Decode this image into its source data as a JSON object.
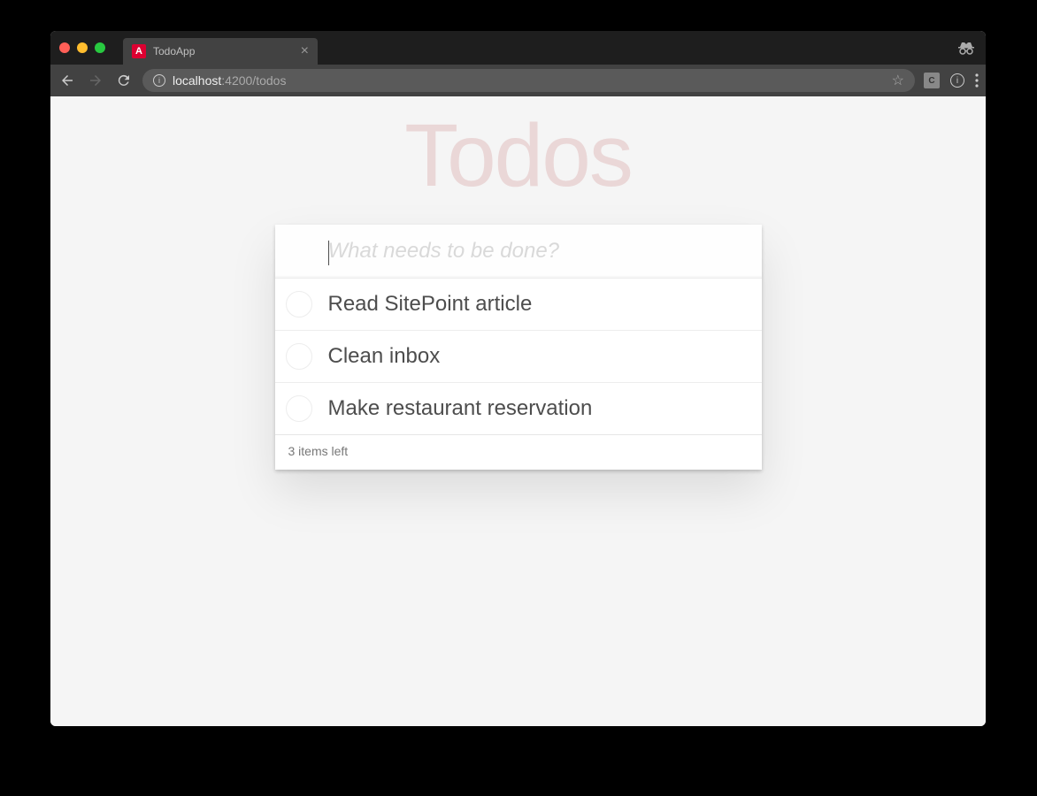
{
  "browser": {
    "tab_title": "TodoApp",
    "url_host": "localhost",
    "url_path": ":4200/todos"
  },
  "app": {
    "title": "Todos",
    "input_placeholder": "What needs to be done?",
    "todos": [
      {
        "label": "Read SitePoint article"
      },
      {
        "label": "Clean inbox"
      },
      {
        "label": "Make restaurant reservation"
      }
    ],
    "footer_count": "3 items left"
  }
}
